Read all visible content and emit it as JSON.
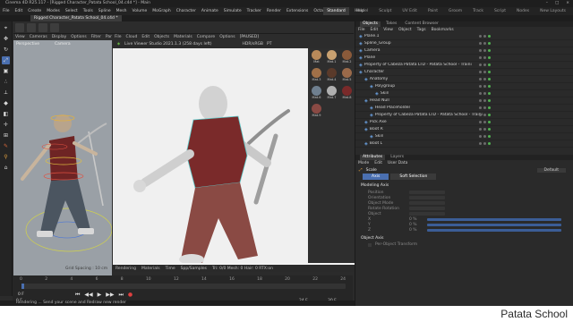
{
  "window": {
    "title": "Cinema 4D R25.117 - [Rigged Character_Patata School_04.c4d *] - Main",
    "controls": [
      "–",
      "□",
      "×"
    ]
  },
  "menubar": {
    "items": [
      "File",
      "Edit",
      "Create",
      "Modes",
      "Select",
      "Tools",
      "Spline",
      "Mesh",
      "Volume",
      "MoGraph",
      "Character",
      "Animate",
      "Simulate",
      "Tracker",
      "Render",
      "Extensions",
      "Octane",
      "Window",
      "Help"
    ],
    "layout_tabs": [
      "Standard",
      "Model",
      "Sculpt",
      "UV Edit",
      "Paint",
      "Groom",
      "Track",
      "Script",
      "Nodes"
    ],
    "active_layout_tab": "Standard",
    "new_layout_label": "New Layouts"
  },
  "document_tab": "Rigged Character_Patata School_04.c4d *",
  "left_viewport": {
    "menu": [
      "View",
      "Cameras",
      "Display",
      "Options",
      "Filter",
      "Panel"
    ],
    "label": "Perspective",
    "camera": "Camera",
    "footer": "Grid Spacing : 10 cm"
  },
  "picture_viewer": {
    "menu": [
      "File",
      "Cloud",
      "Edit",
      "Objects",
      "Materials",
      "Compare",
      "Options"
    ],
    "status": "[PAUSED]",
    "render_info": "Live Viewer Studio 2021.1.3 (258 days left)",
    "hdr_label": "HDR/sRGB",
    "camera_select": "PT",
    "bottom_tabs": [
      "Rendering",
      "Materials",
      "Time",
      "Spp/Samples"
    ],
    "bottom_status": "Tri: 0/0   Mesh: 0   Hair: 0   RTX:on",
    "material_labels": [
      "Mat",
      "Mat.1",
      "Mat.2",
      "Mat.3",
      "Mat.4",
      "Mat.5",
      "Mat.6",
      "Mat.7",
      "Mat.8",
      "Mat.9"
    ]
  },
  "timeline": {
    "ruler": [
      "0",
      "2",
      "4",
      "6",
      "8",
      "10",
      "12",
      "14",
      "16",
      "18",
      "20",
      "22",
      "24"
    ],
    "current_frame": "0 F",
    "start_frame": "0 F",
    "end_frame": "24 F",
    "fps": "30 F"
  },
  "status_bar": "Rendering ...   Send your scene and Redraw new render",
  "objects_panel": {
    "tabs": [
      "Objects",
      "Takes",
      "Content Browser"
    ],
    "active_tab": "Objects",
    "menu": [
      "File",
      "Edit",
      "View",
      "Object",
      "Tags",
      "Bookmarks"
    ],
    "items": [
      {
        "name": "Plane.1",
        "indent": 0
      },
      {
        "name": "Spline_Group",
        "indent": 0
      },
      {
        "name": "Camera",
        "indent": 0
      },
      {
        "name": "Plane",
        "indent": 0
      },
      {
        "name": "Property of Cabeza Patata LTD - Patata School - Training purposes only",
        "indent": 0
      },
      {
        "name": "Character",
        "indent": 0
      },
      {
        "name": "Anatomy",
        "indent": 1
      },
      {
        "name": "Polygroup",
        "indent": 2
      },
      {
        "name": "Skin",
        "indent": 3
      },
      {
        "name": "Head Null",
        "indent": 1
      },
      {
        "name": "Head Placeholder",
        "indent": 2
      },
      {
        "name": "Property of Cabeza Patata LTD - Patata School - Training purposes only",
        "indent": 2
      },
      {
        "name": "Pick Axe",
        "indent": 1
      },
      {
        "name": "Boot R",
        "indent": 1
      },
      {
        "name": "Skin",
        "indent": 2
      },
      {
        "name": "Boot L",
        "indent": 1
      },
      {
        "name": "Skin",
        "indent": 2
      }
    ]
  },
  "attributes_panel": {
    "tabs": [
      "Attributes",
      "Layers"
    ],
    "active_tab": "Attributes",
    "menu": [
      "Mode",
      "Edit",
      "User Data"
    ],
    "header": "Scale",
    "mode": "Default",
    "subtabs": [
      "Axis",
      "Soft Selection"
    ],
    "section_modeling": "Modeling Axis",
    "fields": [
      "Position",
      "Orientation",
      "Object Mode",
      "Rotate Rotation",
      "Object",
      "X",
      "Y",
      "Z"
    ],
    "field_values": [
      "0 %",
      "0 %",
      "0 %"
    ],
    "section_object": "Object Axis",
    "object_axis_label": "Per-Object Transform"
  },
  "watermark": "Patata School",
  "colors": {
    "app_bg": "#2b2b2b",
    "accent_blue": "#4a6fb0",
    "character_shirt": "#7a2a2a",
    "character_pants": "#8a4a44"
  }
}
